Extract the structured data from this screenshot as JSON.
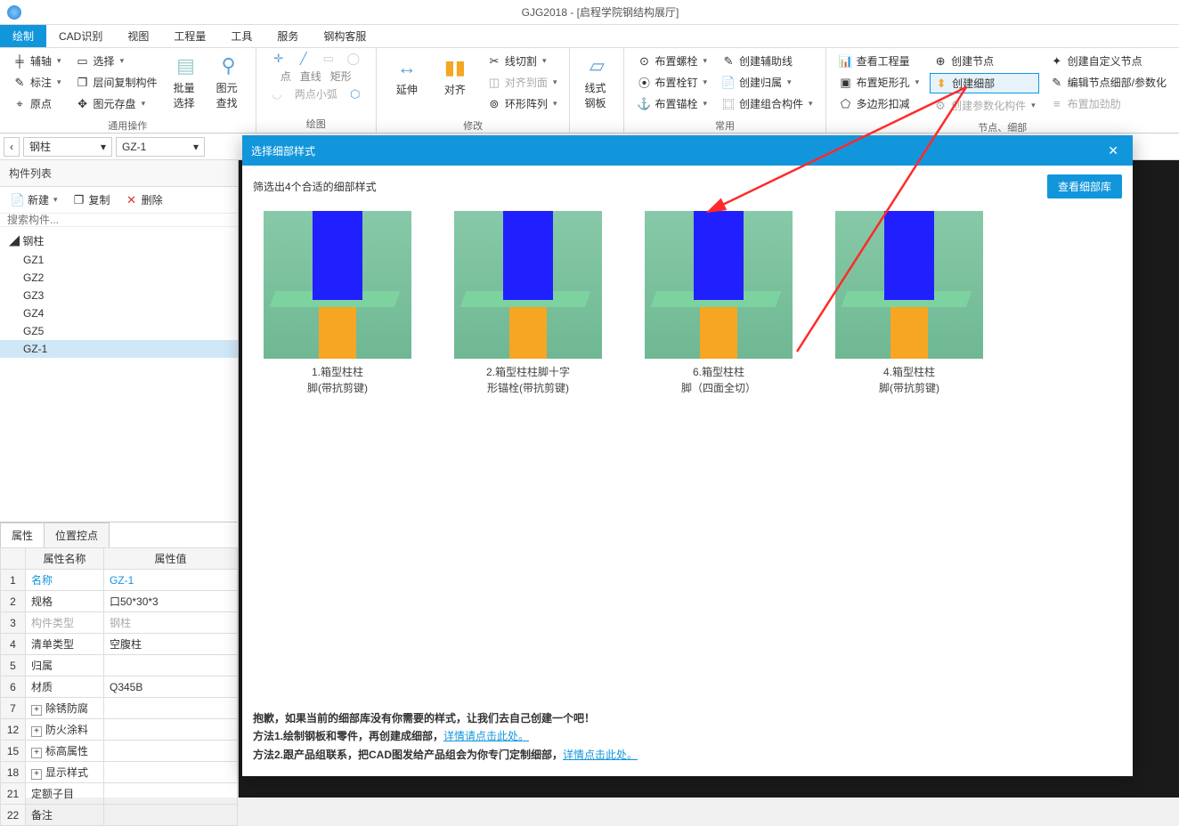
{
  "title": "GJG2018 - [启程学院钢结构展厅]",
  "menu": [
    "绘制",
    "CAD识别",
    "视图",
    "工程量",
    "工具",
    "服务",
    "钢构客服"
  ],
  "ribbon": {
    "g1": {
      "items": [
        "辅轴",
        "选择",
        "标注",
        "层间复制构件",
        "原点",
        "图元存盘"
      ],
      "batch": "批量选择",
      "lookup": "图元查找",
      "label": "通用操作"
    },
    "g2": {
      "items": [
        "点",
        "直线",
        "矩形",
        "两点小弧"
      ],
      "circle": "◯",
      "label": "绘图"
    },
    "g3": {
      "items": [
        "延伸",
        "对齐",
        "线切割",
        "对齐到面",
        "环形阵列"
      ],
      "label": "修改"
    },
    "g4": {
      "big": "线式钢板"
    },
    "g5": {
      "items": [
        "布置螺栓",
        "创建辅助线",
        "布置栓钉",
        "创建归属",
        "布置锚栓",
        "创建组合构件",
        "查看工程量",
        "布置矩形孔",
        "多边形扣减",
        "创建节点",
        "创建细部",
        "创建参数化构件",
        "布置加劲肋",
        "创建自定义节点",
        "编辑节点细部/参数化"
      ],
      "label1": "常用",
      "label2": "节点、细部"
    }
  },
  "selectors": {
    "a": "钢柱",
    "b": "GZ-1"
  },
  "componentList": {
    "title": "构件列表",
    "buttons": {
      "new": "新建",
      "copy": "复制",
      "del": "删除"
    },
    "searchPlaceholder": "搜索构件...",
    "root": "钢柱",
    "items": [
      "GZ1",
      "GZ2",
      "GZ3",
      "GZ4",
      "GZ5",
      "GZ-1"
    ]
  },
  "propTabs": {
    "a": "属性",
    "b": "位置控点"
  },
  "propHeaders": {
    "name": "属性名称",
    "value": "属性值"
  },
  "props": [
    {
      "n": "1",
      "name": "名称",
      "value": "GZ-1",
      "link": true
    },
    {
      "n": "2",
      "name": "规格",
      "value": "口50*30*3"
    },
    {
      "n": "3",
      "name": "构件类型",
      "value": "钢柱",
      "muted": true
    },
    {
      "n": "4",
      "name": "清单类型",
      "value": "空腹柱"
    },
    {
      "n": "5",
      "name": "归属",
      "value": ""
    },
    {
      "n": "6",
      "name": "材质",
      "value": "Q345B"
    },
    {
      "n": "7",
      "name": "除锈防腐",
      "value": "",
      "exp": true
    },
    {
      "n": "12",
      "name": "防火涂料",
      "value": "",
      "exp": true
    },
    {
      "n": "15",
      "name": "标高属性",
      "value": "",
      "exp": true
    },
    {
      "n": "18",
      "name": "显示样式",
      "value": "",
      "exp": true
    },
    {
      "n": "21",
      "name": "定额子目",
      "value": ""
    },
    {
      "n": "22",
      "name": "备注",
      "value": ""
    }
  ],
  "dialog": {
    "title": "选择细部样式",
    "subtitle": "筛选出4个合适的细部样式",
    "libBtn": "查看细部库",
    "cards": [
      {
        "l1": "1.箱型柱柱",
        "l2": "脚(带抗剪键)"
      },
      {
        "l1": "2.箱型柱柱脚十字",
        "l2": "形锚栓(带抗剪键)"
      },
      {
        "l1": "6.箱型柱柱",
        "l2": "脚（四面全切）"
      },
      {
        "l1": "4.箱型柱柱",
        "l2": "脚(带抗剪键)"
      }
    ],
    "footer": {
      "line1a": "抱歉，如果当前的细部库没有你需要的样式，让我们去自己创建一个吧！",
      "line2a": "方法1.绘制钢板和零件，再创建成细部，",
      "link2": "详情请点击此处。",
      "line3a": "方法2.跟产品组联系，把CAD图发给产品组会为你专门定制细部，",
      "link3": "详情点击此处。"
    }
  }
}
